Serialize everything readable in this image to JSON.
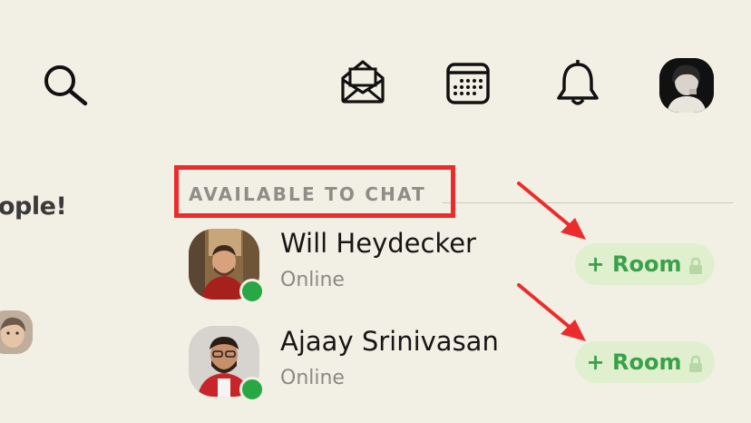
{
  "left_partial_text": "ople!",
  "section": {
    "header": "AVAILABLE TO CHAT"
  },
  "users": [
    {
      "name": "Will Heydecker",
      "status": "Online",
      "room_label": "+ Room"
    },
    {
      "name": "Ajaay Srinivasan",
      "status": "Online",
      "room_label": "+ Room"
    }
  ],
  "icons": [
    "search-icon",
    "envelope-open-icon",
    "calendar-icon",
    "bell-icon"
  ],
  "colors": {
    "background": "#f2efe4",
    "online": "#28a745",
    "room_button_bg": "#e0f0ce",
    "room_button_text": "#3aa14a",
    "annotation": "#ec2c2c"
  }
}
